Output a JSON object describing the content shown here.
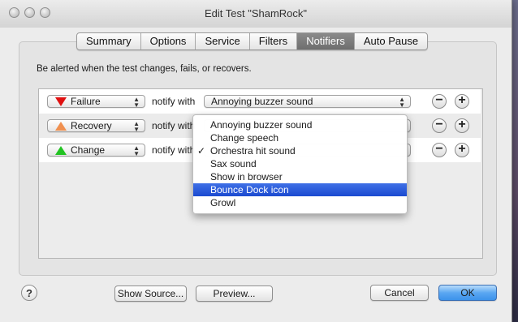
{
  "window": {
    "title": "Edit Test \"ShamRock\""
  },
  "tabs": [
    {
      "label": "Summary",
      "active": false
    },
    {
      "label": "Options",
      "active": false
    },
    {
      "label": "Service",
      "active": false
    },
    {
      "label": "Filters",
      "active": false
    },
    {
      "label": "Notifiers",
      "active": true
    },
    {
      "label": "Auto Pause",
      "active": false
    }
  ],
  "intro": "Be alerted when the test changes, fails, or recovers.",
  "rows": [
    {
      "event": "Failure",
      "icon": "red-down-triangle-icon",
      "notify": "notify with",
      "sound": "Annoying buzzer sound"
    },
    {
      "event": "Recovery",
      "icon": "orange-up-triangle-icon",
      "notify": "notify with",
      "sound": ""
    },
    {
      "event": "Change",
      "icon": "green-up-triangle-icon",
      "notify": "notify with",
      "sound": ""
    }
  ],
  "menu": {
    "items": [
      {
        "label": "Annoying buzzer sound",
        "checked": false,
        "highlighted": false
      },
      {
        "label": "Change speech",
        "checked": false,
        "highlighted": false
      },
      {
        "label": "Orchestra hit sound",
        "checked": true,
        "highlighted": false
      },
      {
        "label": "Sax sound",
        "checked": false,
        "highlighted": false
      },
      {
        "label": "Show in browser",
        "checked": false,
        "highlighted": false
      },
      {
        "label": "Bounce Dock icon",
        "checked": false,
        "highlighted": true
      },
      {
        "label": "Growl",
        "checked": false,
        "highlighted": false
      }
    ],
    "check_glyph": "✓"
  },
  "buttons": {
    "help": "?",
    "show_source": "Show Source...",
    "preview": "Preview...",
    "cancel": "Cancel",
    "ok": "OK",
    "remove": "−",
    "add": "+"
  },
  "colors": {
    "failure": "#e01010",
    "recovery": "#f09050",
    "change": "#22c322",
    "highlight": "#2a5bdc"
  }
}
